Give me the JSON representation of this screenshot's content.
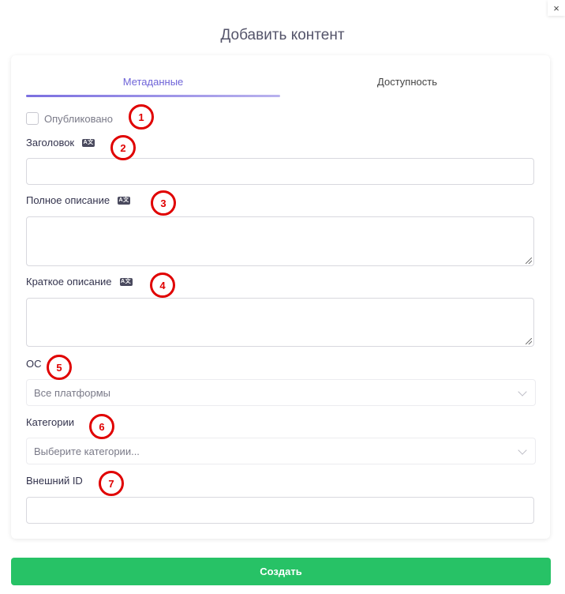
{
  "dialog": {
    "title": "Добавить контент",
    "close_glyph": "×"
  },
  "tabs": [
    {
      "label": "Метаданные",
      "active": true
    },
    {
      "label": "Доступность",
      "active": false
    }
  ],
  "form": {
    "published": {
      "label": "Опубликовано",
      "checked": false
    },
    "title_field": {
      "label": "Заголовок",
      "value": "",
      "icon": "translate-icon"
    },
    "full_description": {
      "label": "Полное описание",
      "value": "",
      "icon": "translate-icon"
    },
    "short_description": {
      "label": "Краткое описание",
      "value": "",
      "icon": "translate-icon"
    },
    "os": {
      "label": "ОС",
      "selected": "Все платформы"
    },
    "categories": {
      "label": "Категории",
      "placeholder": "Выберите категории..."
    },
    "external_id": {
      "label": "Внешний ID",
      "value": ""
    }
  },
  "translate_icon_text": "A文",
  "markers": [
    "1",
    "2",
    "3",
    "4",
    "5",
    "6",
    "7"
  ],
  "submit": {
    "label": "Создать"
  },
  "colors": {
    "accent": "#6f64d8",
    "submit": "#27c266",
    "marker": "#e00000"
  }
}
